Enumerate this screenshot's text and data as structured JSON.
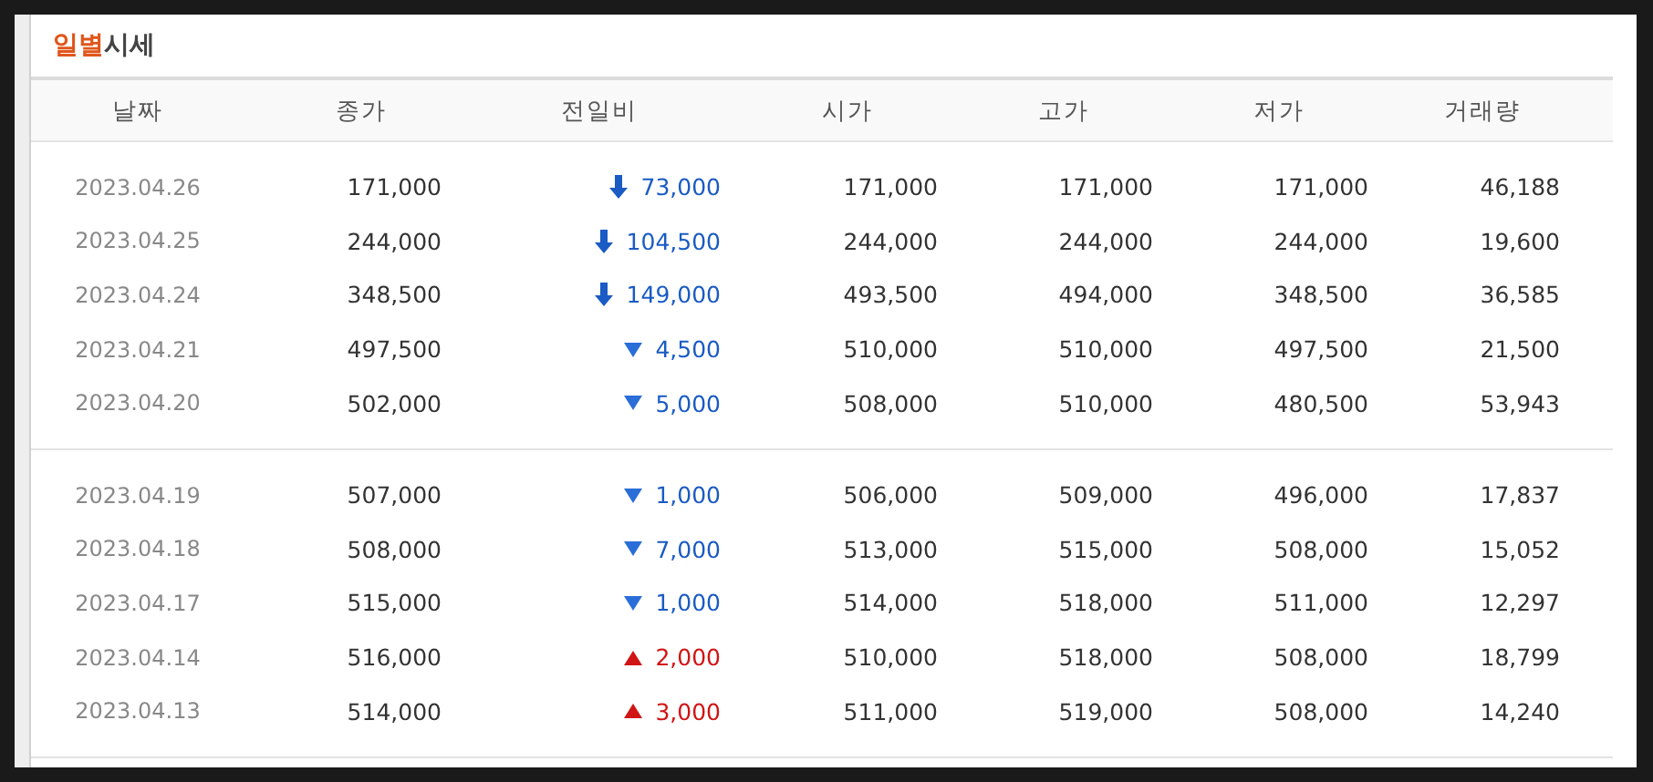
{
  "title": {
    "highlight": "일별",
    "rest": "시세"
  },
  "columns": [
    "날짜",
    "종가",
    "전일비",
    "시가",
    "고가",
    "저가",
    "거래량"
  ],
  "row_groups": [
    {
      "rows": [
        {
          "date": "2023.04.26",
          "close": "171,000",
          "change": {
            "kind": "limit_down",
            "value": "73,000"
          },
          "open": "171,000",
          "high": "171,000",
          "low": "171,000",
          "volume": "46,188"
        },
        {
          "date": "2023.04.25",
          "close": "244,000",
          "change": {
            "kind": "limit_down",
            "value": "104,500"
          },
          "open": "244,000",
          "high": "244,000",
          "low": "244,000",
          "volume": "19,600"
        },
        {
          "date": "2023.04.24",
          "close": "348,500",
          "change": {
            "kind": "limit_down",
            "value": "149,000"
          },
          "open": "493,500",
          "high": "494,000",
          "low": "348,500",
          "volume": "36,585"
        },
        {
          "date": "2023.04.21",
          "close": "497,500",
          "change": {
            "kind": "down",
            "value": "4,500"
          },
          "open": "510,000",
          "high": "510,000",
          "low": "497,500",
          "volume": "21,500"
        },
        {
          "date": "2023.04.20",
          "close": "502,000",
          "change": {
            "kind": "down",
            "value": "5,000"
          },
          "open": "508,000",
          "high": "510,000",
          "low": "480,500",
          "volume": "53,943"
        }
      ]
    },
    {
      "rows": [
        {
          "date": "2023.04.19",
          "close": "507,000",
          "change": {
            "kind": "down",
            "value": "1,000"
          },
          "open": "506,000",
          "high": "509,000",
          "low": "496,000",
          "volume": "17,837"
        },
        {
          "date": "2023.04.18",
          "close": "508,000",
          "change": {
            "kind": "down",
            "value": "7,000"
          },
          "open": "513,000",
          "high": "515,000",
          "low": "508,000",
          "volume": "15,052"
        },
        {
          "date": "2023.04.17",
          "close": "515,000",
          "change": {
            "kind": "down",
            "value": "1,000"
          },
          "open": "514,000",
          "high": "518,000",
          "low": "511,000",
          "volume": "12,297"
        },
        {
          "date": "2023.04.14",
          "close": "516,000",
          "change": {
            "kind": "up",
            "value": "2,000"
          },
          "open": "510,000",
          "high": "518,000",
          "low": "508,000",
          "volume": "18,799"
        },
        {
          "date": "2023.04.13",
          "close": "514,000",
          "change": {
            "kind": "up",
            "value": "3,000"
          },
          "open": "511,000",
          "high": "519,000",
          "low": "508,000",
          "volume": "14,240"
        }
      ]
    }
  ]
}
